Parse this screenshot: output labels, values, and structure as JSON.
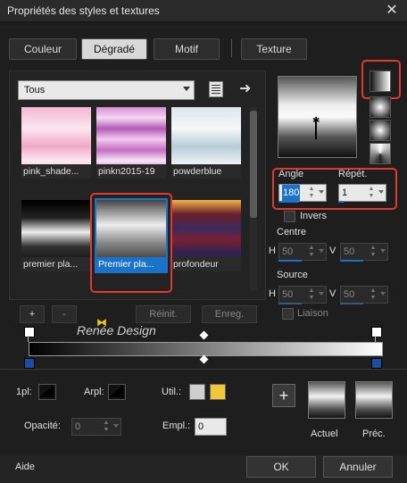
{
  "window": {
    "title": "Propriétés des styles et textures",
    "close_icon": "close-icon"
  },
  "tabs": [
    {
      "label": "Couleur",
      "active": false
    },
    {
      "label": "Dégradé",
      "active": true
    },
    {
      "label": "Motif",
      "active": false
    },
    {
      "label": "Texture",
      "active": false
    }
  ],
  "category": {
    "selected": "Tous"
  },
  "gradients": [
    {
      "label": "pink_shade..."
    },
    {
      "label": "pinkn2015-19"
    },
    {
      "label": "powderblue"
    },
    {
      "label": "premier pla..."
    },
    {
      "label": "Premier pla...",
      "selected": true
    },
    {
      "label": "profondeur"
    }
  ],
  "gradient_actions": {
    "add": "+",
    "remove": "-",
    "reset": "Réinit.",
    "save": "Enreg."
  },
  "watermark": "Renée Design",
  "angle": {
    "label": "Angle",
    "value": "180"
  },
  "repeat": {
    "label": "Répét.",
    "value": "1"
  },
  "invert": {
    "label": "Invers"
  },
  "center": {
    "label": "Centre",
    "h_label": "H",
    "h_value": "50",
    "v_label": "V",
    "v_value": "50"
  },
  "source": {
    "label": "Source",
    "h_label": "H",
    "h_value": "50",
    "v_label": "V",
    "v_value": "50"
  },
  "link": {
    "label": "Liaison"
  },
  "bottom": {
    "pl_label": "1pl:",
    "arpl_label": "Arpl:",
    "util_label": "Util.:",
    "opacity_label": "Opacité:",
    "opacity_value": "0",
    "empl_label": "Empl.:",
    "empl_value": "0",
    "swatch_color": "#f2c63a"
  },
  "previews": {
    "current": "Actuel",
    "previous": "Préc."
  },
  "footer": {
    "help": "Aide",
    "ok": "OK",
    "cancel": "Annuler"
  },
  "accent": "#1a73c8",
  "highlight": "#e03a2f"
}
